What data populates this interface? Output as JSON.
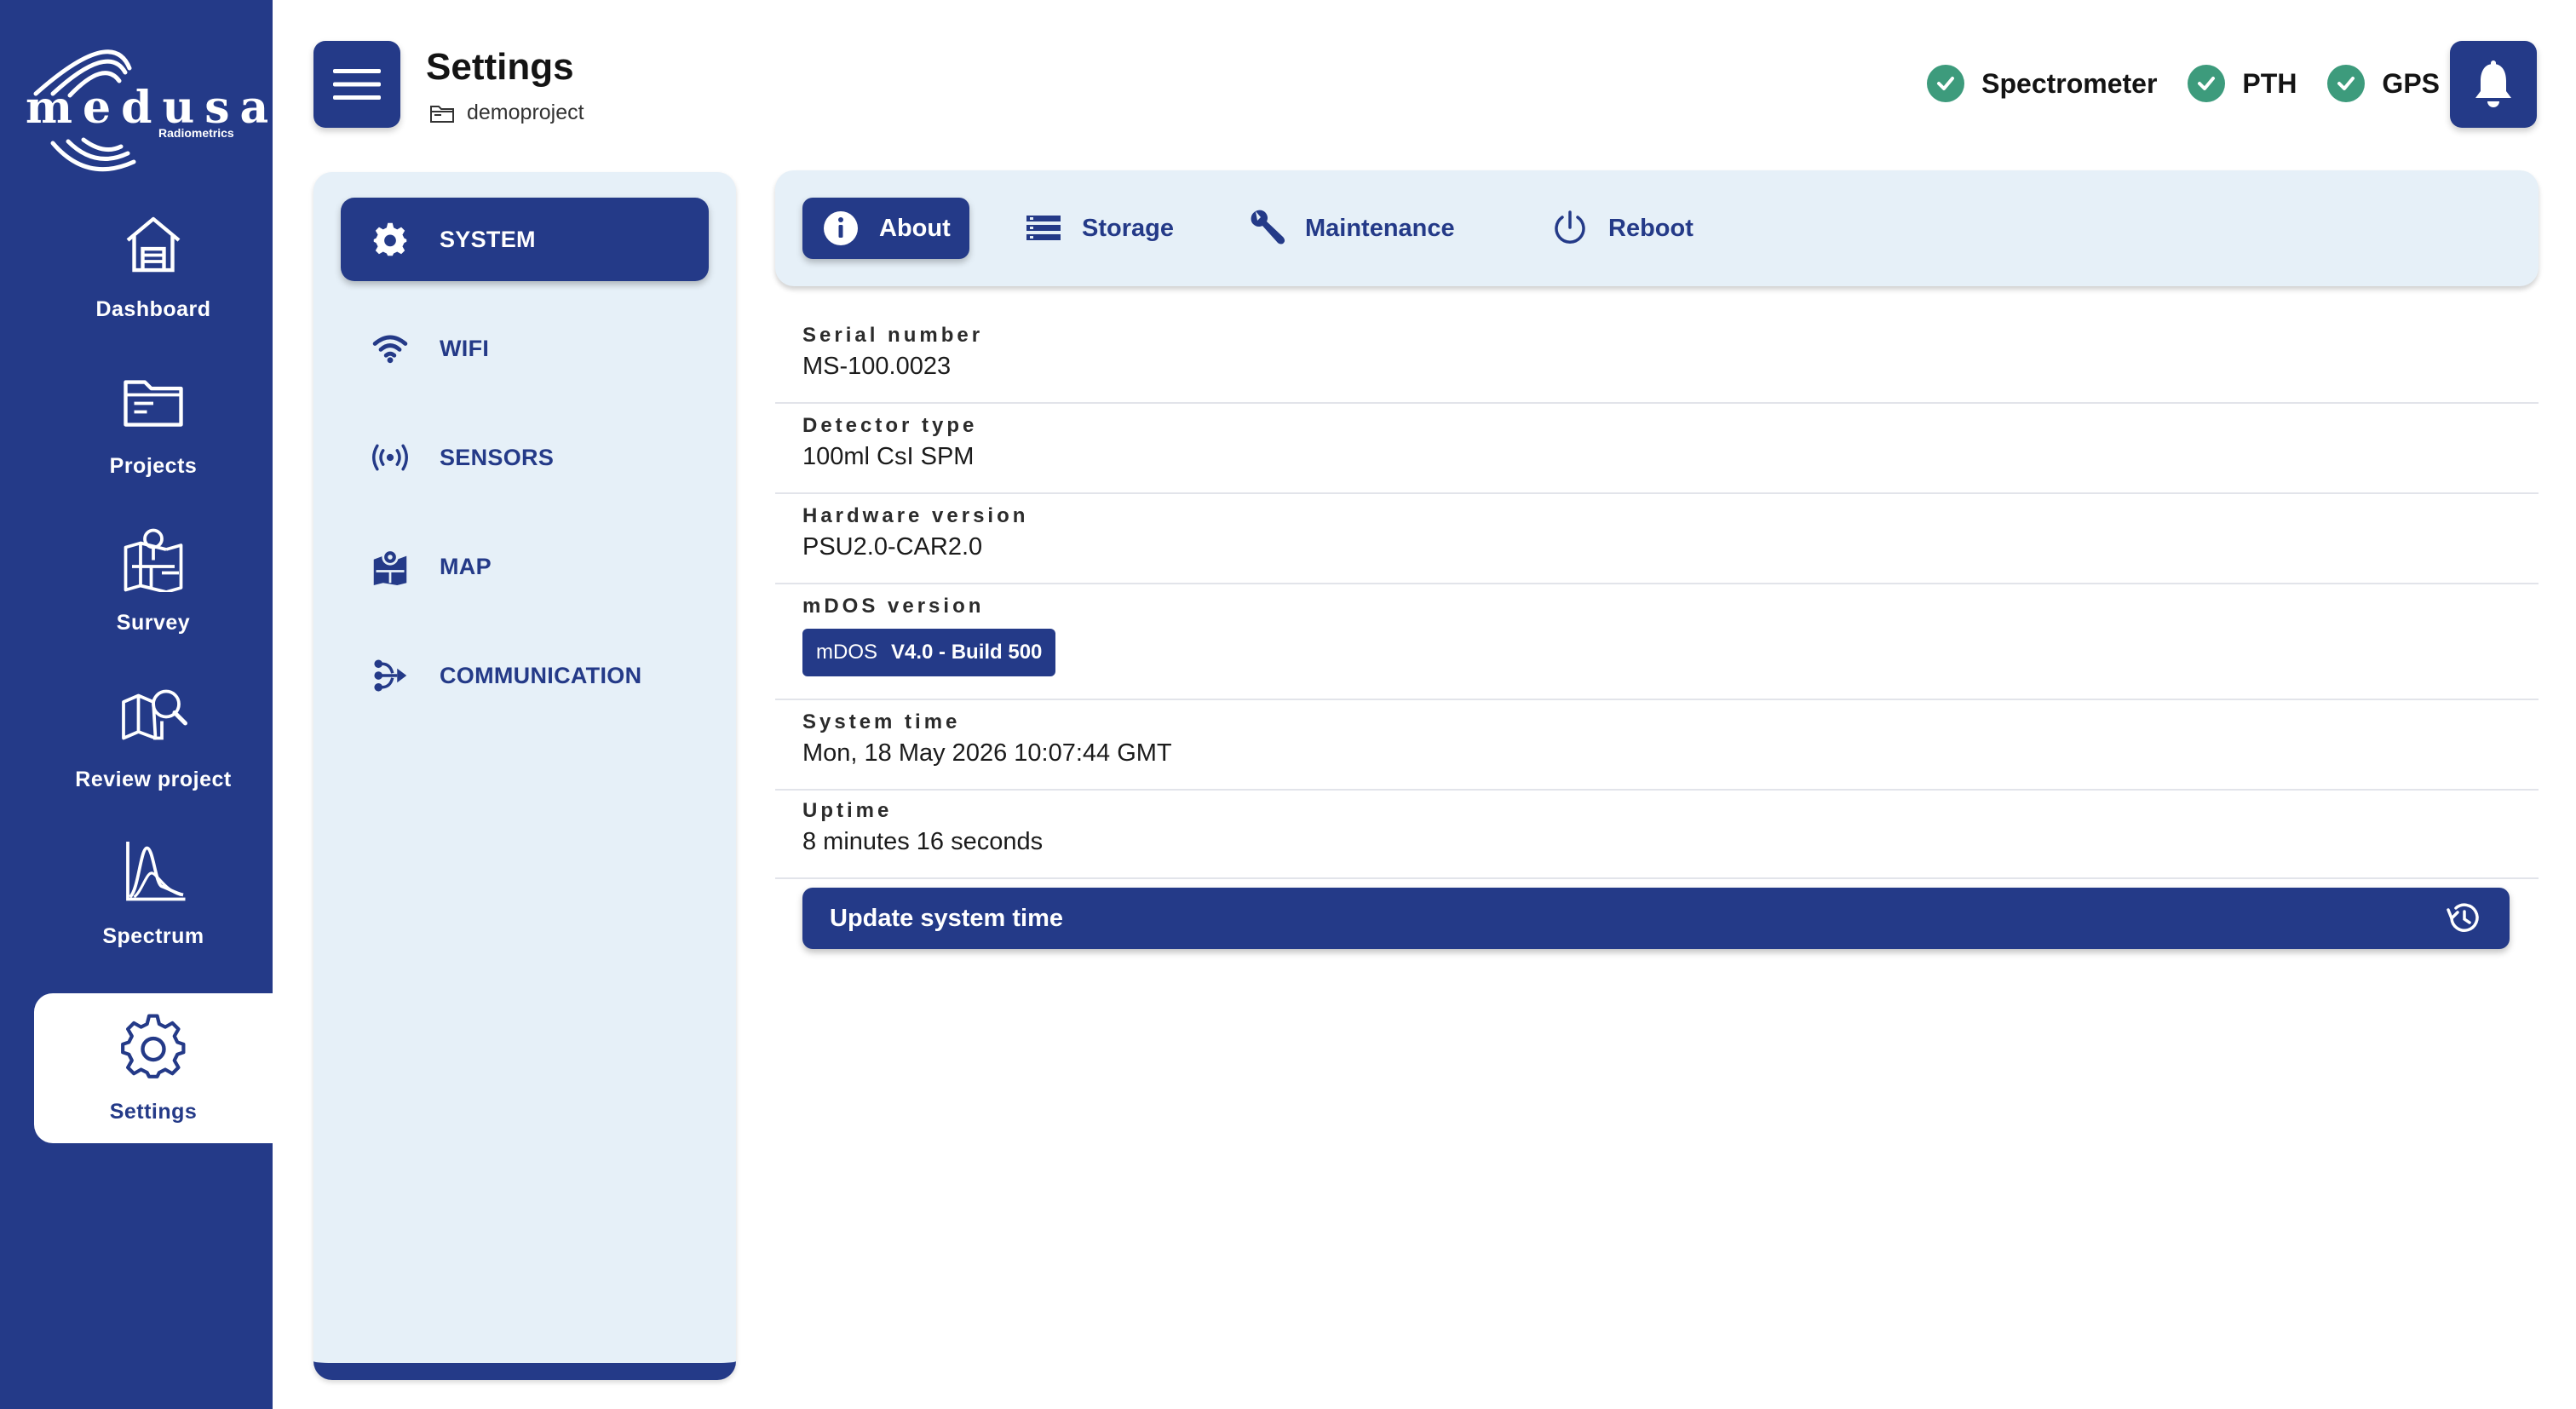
{
  "brand": {
    "name": "medusa",
    "subtitle": "Radiometrics"
  },
  "nav": {
    "items": [
      {
        "label": "Dashboard",
        "icon": "house-icon"
      },
      {
        "label": "Projects",
        "icon": "folder-icon"
      },
      {
        "label": "Survey",
        "icon": "survey-map-icon"
      },
      {
        "label": "Review project",
        "icon": "map-search-icon"
      },
      {
        "label": "Spectrum",
        "icon": "spectrum-chart-icon"
      },
      {
        "label": "Settings",
        "icon": "gear-icon",
        "active": true
      }
    ]
  },
  "header": {
    "title": "Settings",
    "project": "demoproject",
    "statuses": [
      {
        "label": "Spectrometer",
        "ok": true
      },
      {
        "label": "PTH",
        "ok": true
      },
      {
        "label": "GPS",
        "ok": true
      }
    ]
  },
  "categories": [
    {
      "label": "SYSTEM",
      "icon": "gear-icon",
      "active": true
    },
    {
      "label": "WIFI",
      "icon": "wifi-icon"
    },
    {
      "label": "SENSORS",
      "icon": "sensor-broadcast-icon"
    },
    {
      "label": "MAP",
      "icon": "map-pin-icon"
    },
    {
      "label": "COMMUNICATION",
      "icon": "share-nodes-icon"
    }
  ],
  "tabs": [
    {
      "label": "About",
      "icon": "info-icon",
      "active": true
    },
    {
      "label": "Storage",
      "icon": "storage-list-icon"
    },
    {
      "label": "Maintenance",
      "icon": "wrench-icon"
    },
    {
      "label": "Reboot",
      "icon": "power-icon"
    }
  ],
  "about": {
    "serial": {
      "label": "Serial number",
      "value": "MS-100.0023"
    },
    "detector": {
      "label": "Detector type",
      "value": "100ml CsI SPM"
    },
    "hardware": {
      "label": "Hardware version",
      "value": "PSU2.0-CAR2.0"
    },
    "mdos": {
      "label": "mDOS version",
      "prefix": "mDOS",
      "value": "V4.0 - Build 500"
    },
    "time": {
      "label": "System time",
      "value": "Mon, 18 May 2026 10:07:44 GMT"
    },
    "uptime": {
      "label": "Uptime",
      "value": "8 minutes 16 seconds"
    }
  },
  "update_button": {
    "label": "Update system time",
    "icon": "history-icon"
  },
  "colors": {
    "primary": "#243a88",
    "panel": "#e6f0f8",
    "ok": "#3d9b7c"
  }
}
